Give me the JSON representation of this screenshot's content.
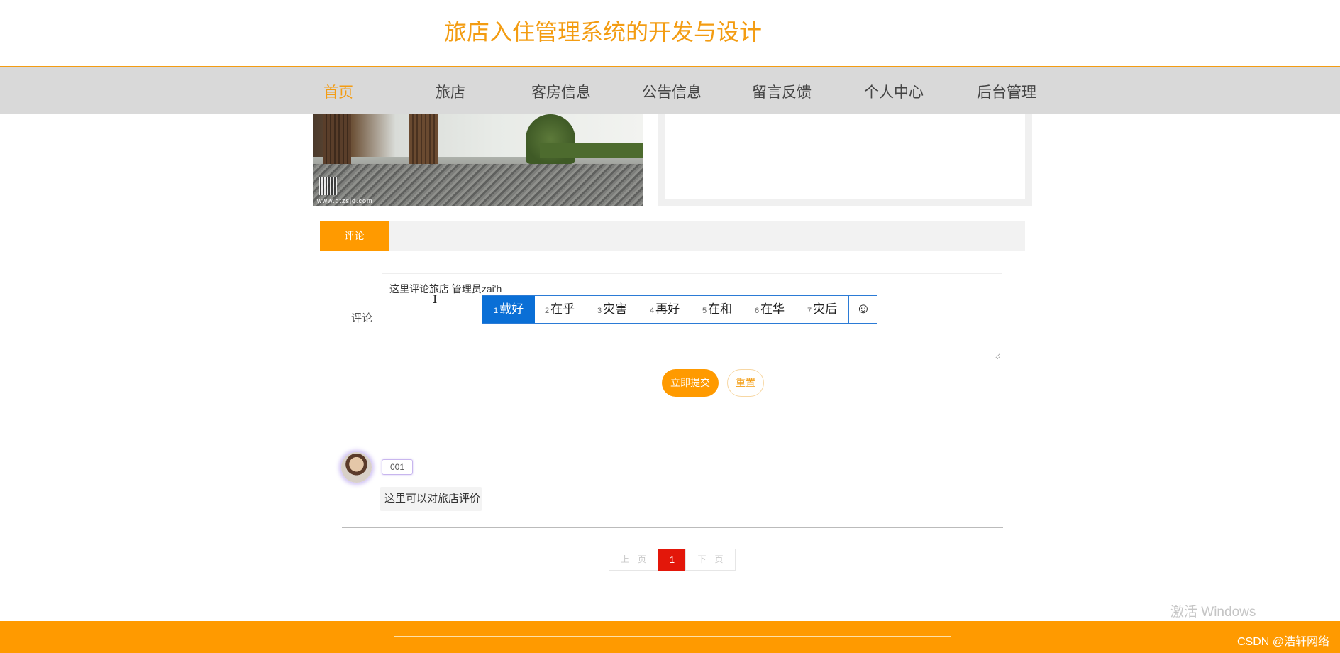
{
  "header": {
    "title": "旅店入住管理系统的开发与设计"
  },
  "nav": {
    "items": [
      {
        "label": "首页",
        "active": true
      },
      {
        "label": "旅店"
      },
      {
        "label": "客房信息"
      },
      {
        "label": "公告信息"
      },
      {
        "label": "留言反馈"
      },
      {
        "label": "个人中心"
      },
      {
        "label": "后台管理"
      }
    ]
  },
  "hero": {
    "watermark_url": "www.gtzsjd.com"
  },
  "tabs": {
    "comment": "评论"
  },
  "comment_form": {
    "label": "评论",
    "value": "这里评论旅店 管理员zai'h",
    "submit_label": "立即提交",
    "reset_label": "重置"
  },
  "ime": {
    "candidates": [
      {
        "num": "1",
        "text": "载好"
      },
      {
        "num": "2",
        "text": "在乎"
      },
      {
        "num": "3",
        "text": "灾害"
      },
      {
        "num": "4",
        "text": "再好"
      },
      {
        "num": "5",
        "text": "在和"
      },
      {
        "num": "6",
        "text": "在华"
      },
      {
        "num": "7",
        "text": "灾后"
      }
    ],
    "emoji": "☺"
  },
  "comments": [
    {
      "username": "001",
      "text": "这里可以对旅店评价"
    }
  ],
  "pagination": {
    "prev": "上一页",
    "current": "1",
    "next": "下一页"
  },
  "overlay": {
    "windows_activate": "激活 Windows",
    "csdn": "CSDN @浩轩网络"
  },
  "colors": {
    "accent": "#ff9a00",
    "nav_bg": "#d9d9d9",
    "page_current": "#e3170a",
    "ime_select": "#0a6fd6"
  }
}
